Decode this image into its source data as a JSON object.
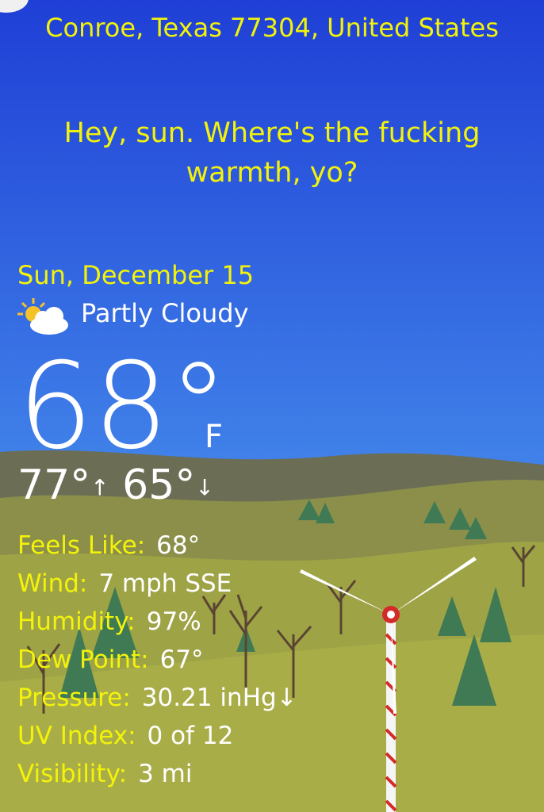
{
  "location": "Conroe, Texas 77304, United States",
  "headline": "Hey, sun. Where's the fucking warmth, yo?",
  "date": "Sun, December 15",
  "condition": {
    "icon": "partly-cloudy-icon",
    "text": "Partly Cloudy"
  },
  "current": {
    "temp": "68°",
    "unit": "F"
  },
  "hilo": {
    "high": "77°",
    "high_arrow": "↑",
    "low": "65°",
    "low_arrow": "↓"
  },
  "details": [
    {
      "label": "Feels Like:",
      "value": "68°"
    },
    {
      "label": "Wind:",
      "value": "7 mph SSE"
    },
    {
      "label": "Humidity:",
      "value": "97%"
    },
    {
      "label": "Dew Point:",
      "value": "67°"
    },
    {
      "label": "Pressure:",
      "value": "30.21 inHg↓"
    },
    {
      "label": "UV Index:",
      "value": "0 of 12"
    },
    {
      "label": "Visibility:",
      "value": "3 mi"
    }
  ],
  "colors": {
    "sky_top": "#1f3fd6",
    "sky_bottom": "#5ea6f5",
    "accent_yellow": "#f3f30a",
    "grass": "#9b9f45"
  }
}
